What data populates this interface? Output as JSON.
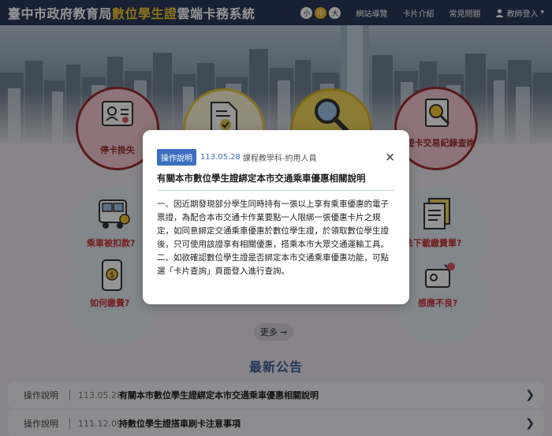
{
  "header": {
    "title_part1": "臺中市政府教育局",
    "title_highlight": "數位學生證",
    "title_part2": "雲端卡務系統",
    "font_sizes": [
      "小",
      "中",
      "大"
    ],
    "nav": [
      "網站導覽",
      "卡片介紹",
      "常見問題"
    ],
    "user_label": "教師登入",
    "user_caret": "▾"
  },
  "services": {
    "row1": [
      "停卡掛失",
      "悠遊卡交易紀錄查詢"
    ],
    "row2": [
      "乘車被扣款?",
      "無法下載繳費單?"
    ],
    "row3": [
      "如何繳費?",
      "感應不良?"
    ]
  },
  "more": {
    "label": "更多",
    "arrow": "→"
  },
  "news": {
    "heading": "最新公告",
    "items": [
      {
        "category": "操作說明",
        "date": "113.05.28",
        "title": "有關本市數位學生證綁定本市交通乘車優惠相關說明"
      },
      {
        "category": "操作說明",
        "date": "111.12.09",
        "title": "持數位學生證搭車刷卡注意事項"
      }
    ]
  },
  "modal": {
    "badge": "操作說明",
    "date": "113.05.28",
    "unit": "課程教學科-約用人員",
    "close": "×",
    "title": "有關本市數位學生證綁定本市交通乘車優惠相關說明",
    "para1": "一、因近期發現部分學生同時持有一張以上享有乘車優惠的電子票證，為配合本市交通卡作業要點一人限綁一張優惠卡片之規定，如同意綁定交通乘車優惠於數位學生證，於領取數位學生證後，只可使用該證享有相關優惠，搭乘本市大眾交通運輸工具。",
    "para2": "二、如欲確認數位學生證是否綁定本市交通乘車優惠功能，可點選「卡片查詢」頁面登入進行查詢。"
  },
  "colors": {
    "header_bg": "#2a3a59",
    "highlight": "#f3c52e",
    "badge": "#3c6fc0",
    "tile_red": "#9b2d2d",
    "tile_pink": "#f2c9cf",
    "tile_yellow": "#f0d45c"
  }
}
